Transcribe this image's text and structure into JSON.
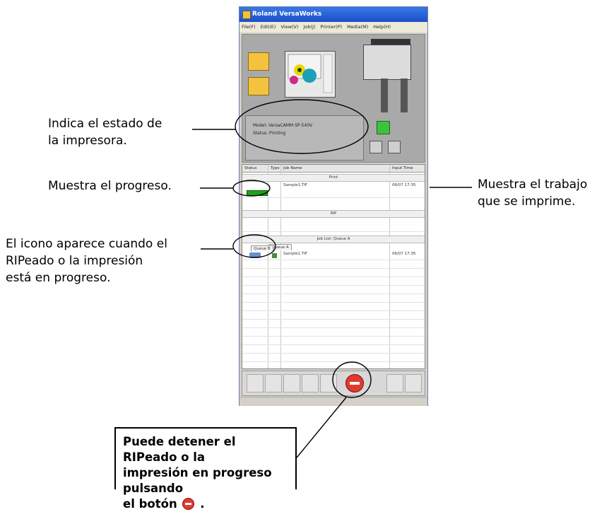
{
  "window": {
    "title": "Roland VersaWorks",
    "menu": [
      "File(F)",
      "Edit(E)",
      "View(V)",
      "Job(J)",
      "Printer(P)",
      "Media(M)",
      "Help(H)"
    ]
  },
  "printer_status": {
    "model_line": "Model: VersaCAMM SP-540V",
    "status_line": "Status: Printing"
  },
  "job_list": {
    "columns": [
      "Status",
      "Type",
      "Job Name",
      "Input Time"
    ],
    "print_section": "Print",
    "printing_job": {
      "name": "Sample1.TIF",
      "time": "06/07 17:35"
    },
    "rip_section": "RIP",
    "queue_section": "Job List: Queue A",
    "queue_tabs": [
      "Queue A",
      "Queue B"
    ],
    "queued_job": {
      "name": "Sample1.TIF",
      "time": "06/07 17:35"
    }
  },
  "annotations": {
    "status_line1": "Indica el estado de",
    "status_line2": "la impresora.",
    "progress": "Muestra el progreso.",
    "job_line1": "Muestra el trabajo",
    "job_line2": "que se imprime.",
    "icon_line1": "El icono aparece cuando el",
    "icon_line2": "RIPeado o la impresión",
    "icon_line3": "está en progreso."
  },
  "note": {
    "line1": "Puede detener el RIPeado o la",
    "line2": "impresión en progreso pulsando",
    "line3_before": "el botón",
    "line3_after": "."
  },
  "colors": {
    "progress_green": "#1aa31a",
    "stop_red": "#e03a2e",
    "titlebar_blue": "#1a4fc9"
  },
  "icons": [
    "folder-icon",
    "preview-icon",
    "printer-icon",
    "stop-icon"
  ]
}
